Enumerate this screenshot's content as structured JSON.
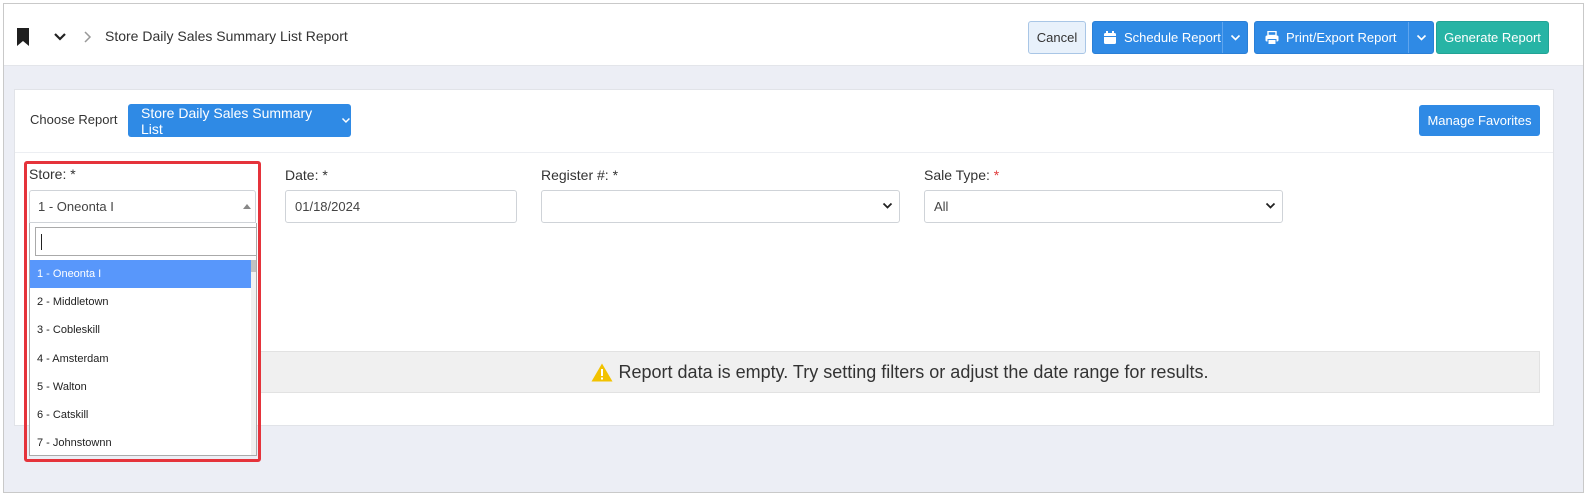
{
  "header": {
    "breadcrumb_title": "Store Daily Sales Summary List Report",
    "cancel_label": "Cancel",
    "schedule_label": "Schedule Report",
    "print_label": "Print/Export Report",
    "generate_label": "Generate Report"
  },
  "report": {
    "choose_label": "Choose Report",
    "selected_report": "Store Daily Sales Summary List",
    "manage_favorites_label": "Manage Favorites"
  },
  "filters": {
    "store": {
      "label": "Store: *",
      "value": "1 - Oneonta I",
      "search_value": ""
    },
    "date": {
      "label": "Date: *",
      "value": "01/18/2024"
    },
    "register": {
      "label": "Register #: *",
      "value": ""
    },
    "sale_type": {
      "label": "Sale Type:",
      "required_mark": "*",
      "value": "All"
    }
  },
  "store_options": [
    "1 - Oneonta I",
    "2 - Middletown",
    "3 - Cobleskill",
    "4 - Amsterdam",
    "5 - Walton",
    "6 - Catskill",
    "7 - Johnstownn"
  ],
  "empty_message": "Report data is empty. Try setting filters or adjust the date range for results.",
  "colors": {
    "primary": "#2f8ae5",
    "success": "#27b4a5",
    "highlight": "#e5333b",
    "warning": "#f2c200",
    "dropdown_active": "#5897fb"
  },
  "icons": {
    "bookmark": "bookmark-icon",
    "chevron_down": "chevron-down-icon",
    "chevron_right": "chevron-right-icon",
    "calendar": "calendar-icon",
    "printer": "printer-icon",
    "warning": "warning-icon"
  }
}
